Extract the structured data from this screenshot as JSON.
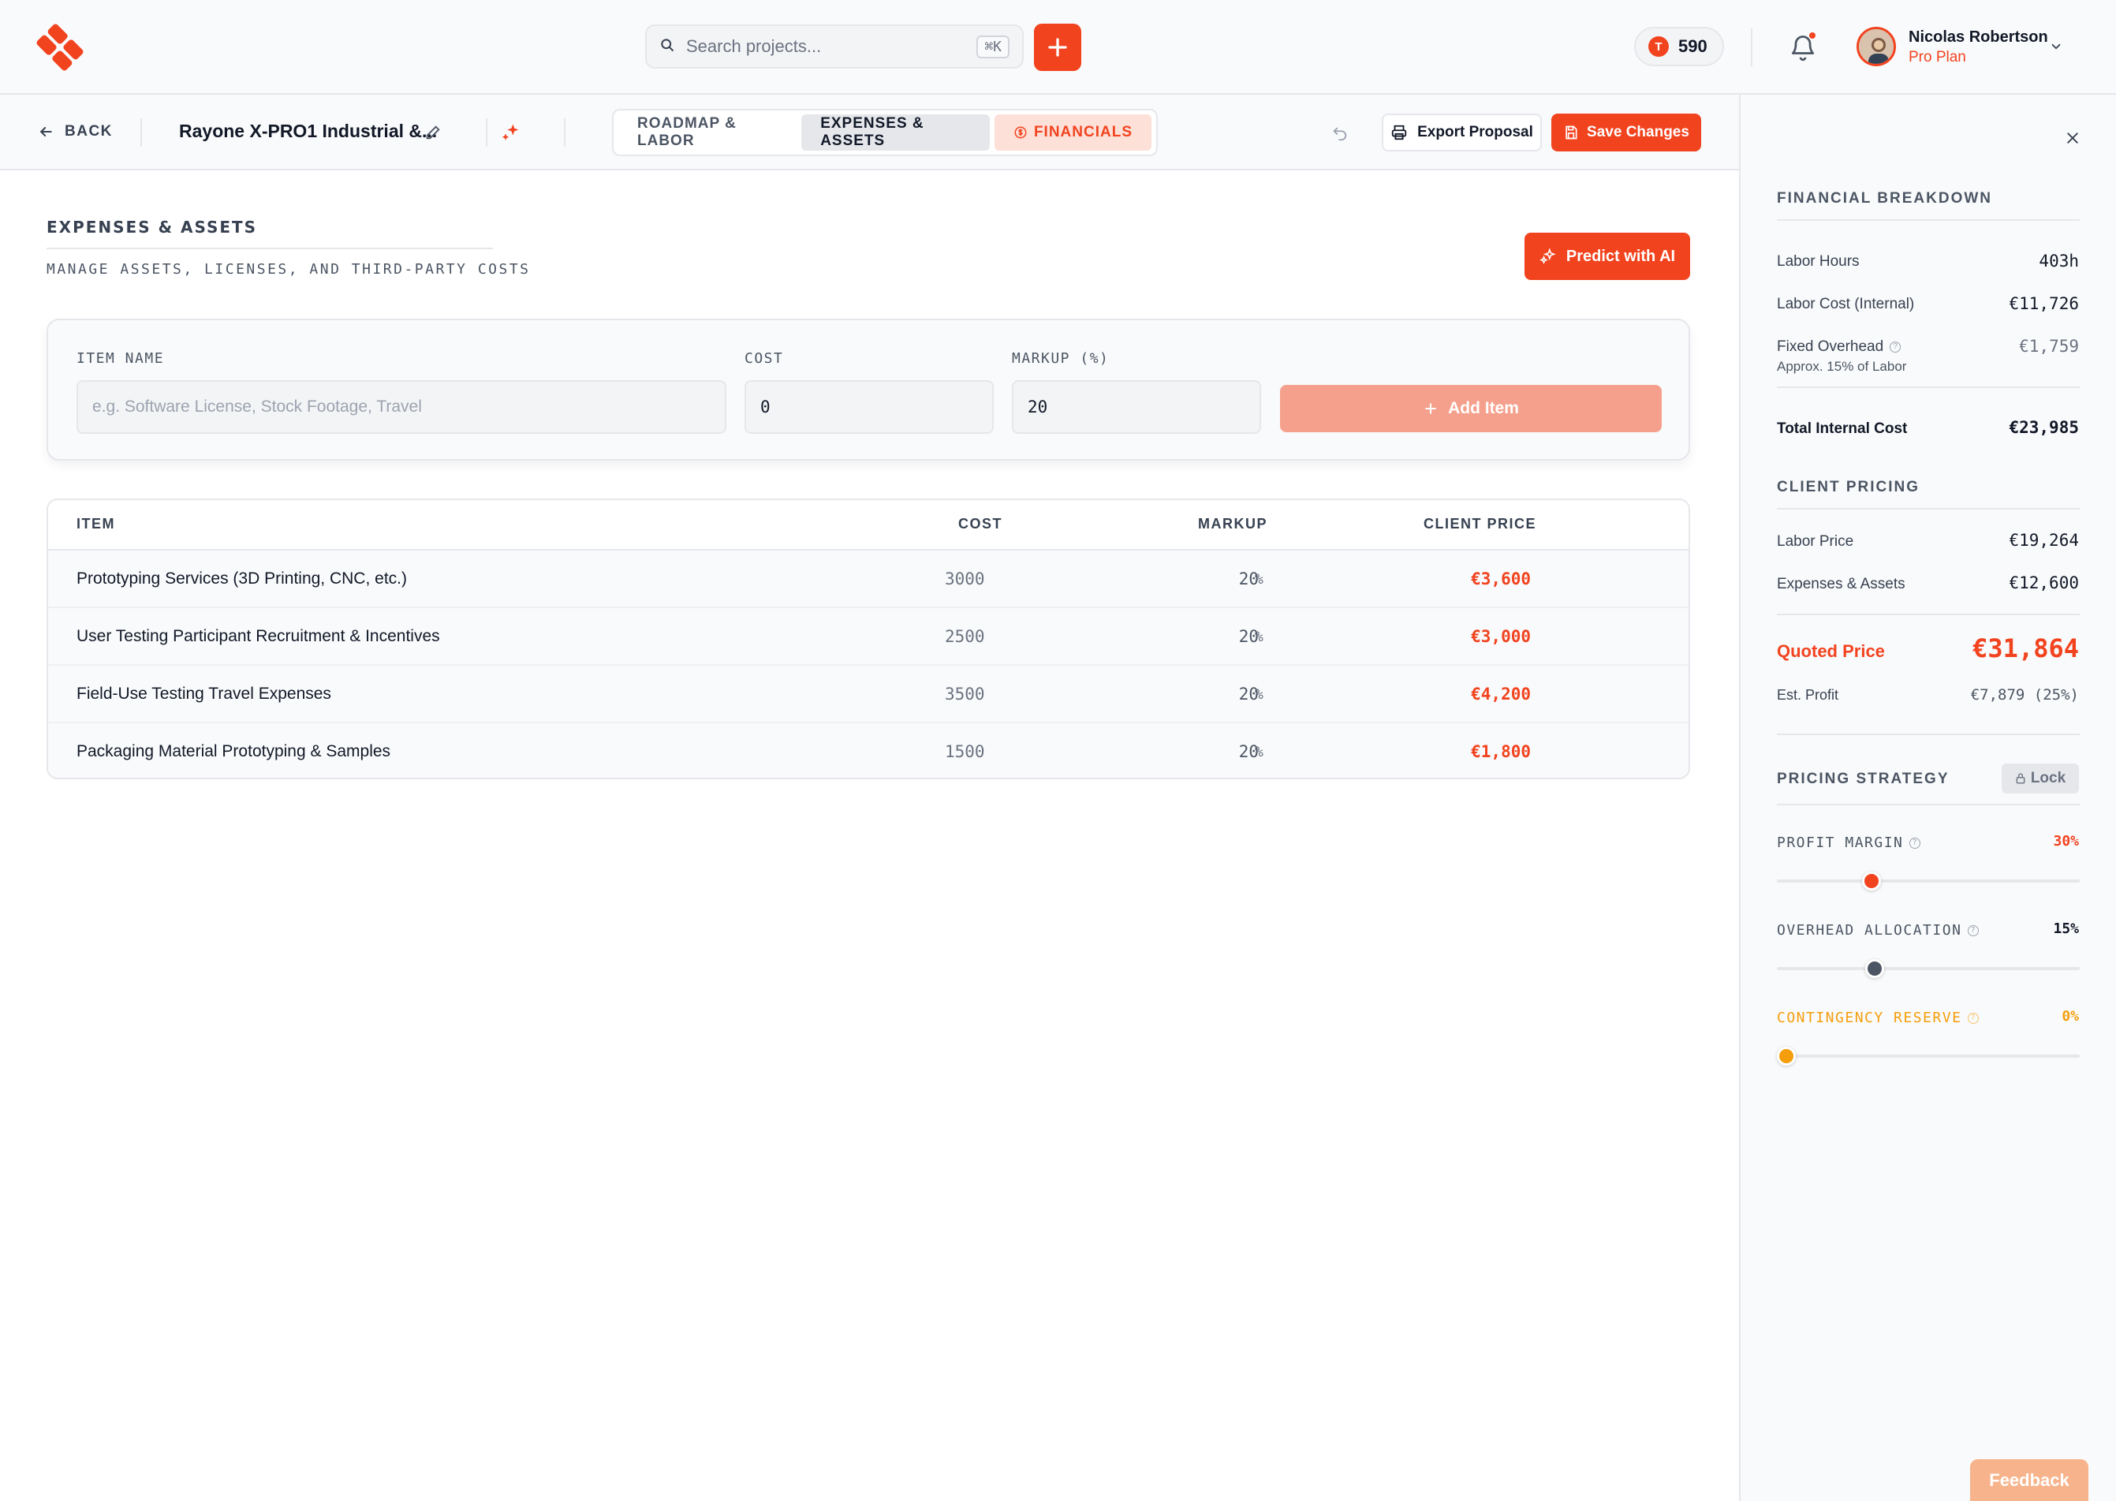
{
  "header": {
    "search_placeholder": "Search projects...",
    "search_shortcut": "⌘K",
    "credits": "590",
    "credit_icon_letter": "T",
    "user_name": "Nicolas Robertson",
    "user_plan": "Pro Plan"
  },
  "subheader": {
    "back_label": "BACK",
    "project_title": "Rayone X-PRO1 Industrial &...",
    "tabs": [
      {
        "label": "ROADMAP & LABOR",
        "state": "default"
      },
      {
        "label": "EXPENSES & ASSETS",
        "state": "active"
      },
      {
        "label": "FINANCIALS",
        "state": "highlight"
      }
    ],
    "export_label": "Export Proposal",
    "save_label": "Save Changes"
  },
  "main": {
    "title": "EXPENSES & ASSETS",
    "subtitle": "MANAGE ASSETS, LICENSES, AND THIRD-PARTY COSTS",
    "predict_label": "Predict with AI",
    "form": {
      "item_name_label": "ITEM NAME",
      "item_name_placeholder": "e.g. Software License, Stock Footage, Travel",
      "cost_label": "COST",
      "cost_value": "0",
      "markup_label": "MARKUP (%)",
      "markup_value": "20",
      "add_label": "Add Item"
    },
    "table": {
      "headers": {
        "item": "ITEM",
        "cost": "COST",
        "markup": "MARKUP",
        "client_price": "CLIENT PRICE"
      },
      "rows": [
        {
          "item": "Prototyping Services (3D Printing, CNC, etc.)",
          "cost": "3000",
          "markup": "20",
          "pct": "%",
          "price": "€3,600"
        },
        {
          "item": "User Testing Participant Recruitment & Incentives",
          "cost": "2500",
          "markup": "20",
          "pct": "%",
          "price": "€3,000"
        },
        {
          "item": "Field-Use Testing Travel Expenses",
          "cost": "3500",
          "markup": "20",
          "pct": "%",
          "price": "€4,200"
        },
        {
          "item": "Packaging Material Prototyping & Samples",
          "cost": "1500",
          "markup": "20",
          "pct": "%",
          "price": "€1,800"
        }
      ]
    }
  },
  "panel": {
    "breakdown_title": "FINANCIAL BREAKDOWN",
    "labor_hours_label": "Labor Hours",
    "labor_hours_value": "403h",
    "labor_cost_label": "Labor Cost (Internal)",
    "labor_cost_value": "€11,726",
    "overhead_label": "Fixed Overhead",
    "overhead_value": "€1,759",
    "overhead_note": "Approx. 15% of Labor",
    "total_internal_label": "Total Internal Cost",
    "total_internal_value": "€23,985",
    "client_pricing_title": "CLIENT PRICING",
    "labor_price_label": "Labor Price",
    "labor_price_value": "€19,264",
    "expenses_label": "Expenses & Assets",
    "expenses_value": "€12,600",
    "quoted_label": "Quoted Price",
    "quoted_value": "€31,864",
    "profit_label": "Est. Profit",
    "profit_value": "€7,879 (25%)",
    "strategy_title": "PRICING STRATEGY",
    "lock_label": "Lock",
    "sliders": [
      {
        "label": "PROFIT MARGIN",
        "value": "30%",
        "fraction": 0.3,
        "color": "#f2431f"
      },
      {
        "label": "OVERHEAD ALLOCATION",
        "value": "15%",
        "fraction": 0.31,
        "color": "#4b5563"
      },
      {
        "label": "CONTINGENCY RESERVE",
        "value": "0%",
        "fraction": 0.0,
        "color": "#f59e0b"
      }
    ]
  },
  "feedback_label": "Feedback",
  "colors": {
    "accent": "#f2431f",
    "amber": "#f59e0b",
    "slate": "#4b5563"
  }
}
